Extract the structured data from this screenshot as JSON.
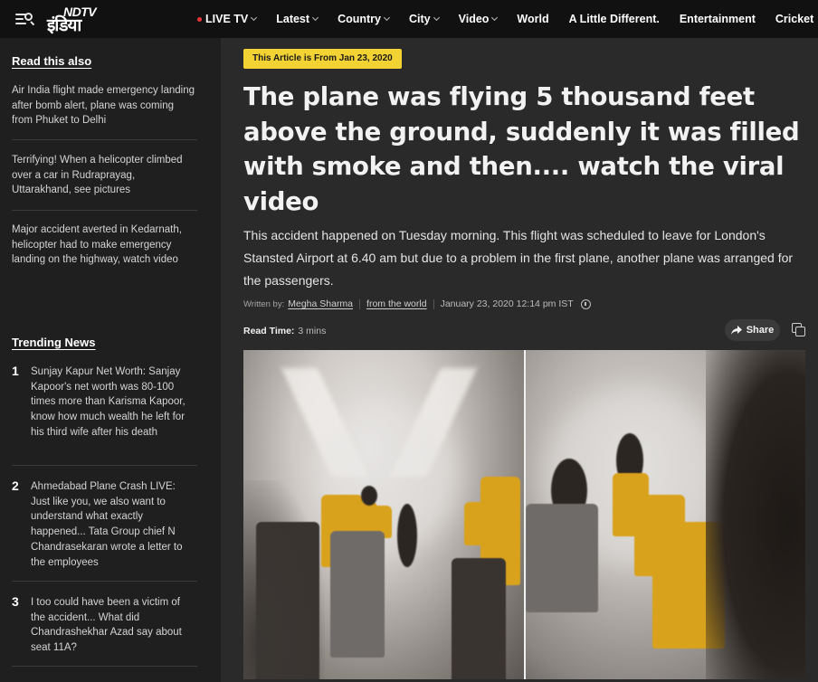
{
  "header": {
    "logo_top": "NDTV",
    "logo_bottom": "इंडिया",
    "nav": [
      {
        "label": "LIVE TV",
        "dot": true,
        "chevron": true
      },
      {
        "label": "Latest",
        "chevron": true
      },
      {
        "label": "Country",
        "chevron": true
      },
      {
        "label": "City",
        "chevron": true
      },
      {
        "label": "Video",
        "chevron": true
      },
      {
        "label": "World",
        "chevron": false
      },
      {
        "label": "A Little Different.",
        "chevron": false
      },
      {
        "label": "Entertainment",
        "chevron": false
      },
      {
        "label": "Cricket",
        "chevron": false
      }
    ]
  },
  "sidebar": {
    "read_also_heading": "Read this also",
    "read_also": [
      "Air India flight made emergency landing after bomb alert, plane was coming from Phuket to Delhi",
      "Terrifying! When a helicopter climbed over a car in Rudraprayag, Uttarakhand, see pictures",
      "Major accident averted in Kedarnath, helicopter had to make emergency landing on the highway, watch video"
    ],
    "trending_heading": "Trending News",
    "trending": [
      {
        "num": "1",
        "text": "Sunjay Kapur Net Worth: Sanjay Kapoor's net worth was 80-100 times more than Karisma Kapoor, know how much wealth he left for his third wife after his death"
      },
      {
        "num": "2",
        "text": "Ahmedabad Plane Crash LIVE: Just like you, we also want to understand what exactly happened... Tata Group chief N Chandrasekaran wrote a letter to the employees"
      },
      {
        "num": "3",
        "text": "I too could have been a victim of the accident... What did Chandrashekhar Azad say about seat 11A?"
      }
    ]
  },
  "article": {
    "date_badge": "This Article is From Jan 23, 2020",
    "headline": "The plane was flying 5 thousand feet above the ground, suddenly it was filled with smoke and then.... watch the viral video",
    "summary": "This accident happened on Tuesday morning. This flight was scheduled to leave for London's Stansted Airport at 6.40 am but due to a problem in the first plane, another plane was arranged for the passengers.",
    "written_by_label": "Written by:",
    "author": "Megha Sharma",
    "section": "from the world",
    "timestamp": "January 23, 2020 12:14 pm IST",
    "read_time_label": "Read Time:",
    "read_time": "3 mins",
    "share_label": "Share"
  },
  "colors": {
    "badge": "#f3d233",
    "live_dot": "#e8333a",
    "seat": "#d9a21c"
  }
}
